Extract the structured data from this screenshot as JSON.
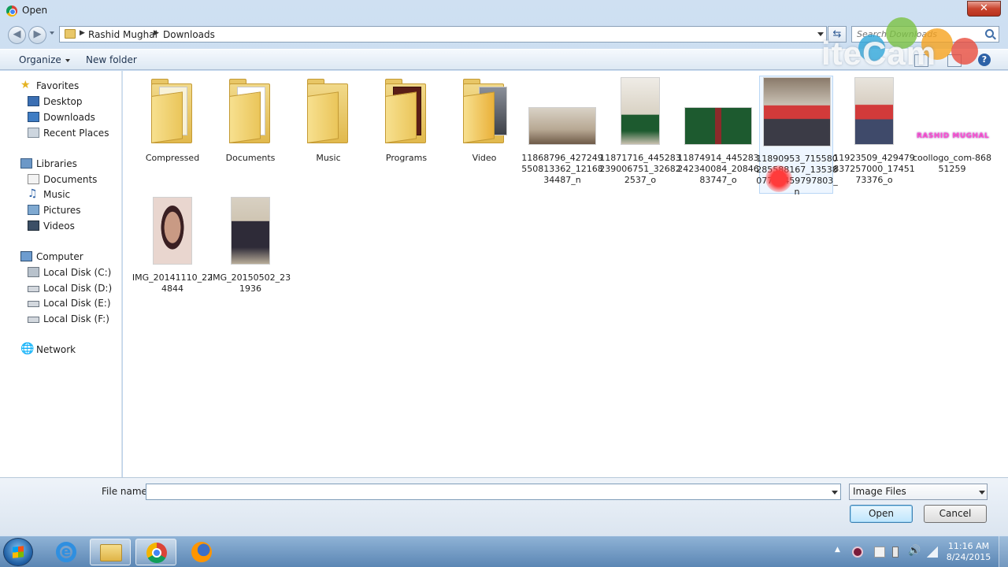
{
  "window": {
    "title": "Open",
    "close_label": "✕"
  },
  "address": {
    "crumbs": [
      "Rashid Mughal",
      "Downloads"
    ],
    "search_placeholder": "Search Downloads"
  },
  "toolbar": {
    "organize_label": "Organize",
    "new_folder_label": "New folder"
  },
  "watermark": "iteCam",
  "nav": {
    "favorites": {
      "label": "Favorites",
      "items": [
        "Desktop",
        "Downloads",
        "Recent Places"
      ]
    },
    "libraries": {
      "label": "Libraries",
      "items": [
        "Documents",
        "Music",
        "Pictures",
        "Videos"
      ]
    },
    "computer": {
      "label": "Computer",
      "items": [
        "Local Disk (C:)",
        "Local Disk (D:)",
        "Local Disk (E:)",
        "Local Disk (F:)"
      ]
    },
    "network": {
      "label": "Network"
    }
  },
  "files": [
    {
      "name": "Compressed",
      "kind": "folder"
    },
    {
      "name": "Documents",
      "kind": "folder"
    },
    {
      "name": "Music",
      "kind": "folder"
    },
    {
      "name": "Programs",
      "kind": "folder"
    },
    {
      "name": "Video",
      "kind": "folder"
    },
    {
      "name": "11868796_427249550813362_1216834487_n",
      "kind": "image"
    },
    {
      "name": "11871716_445283239006751_326822537_o",
      "kind": "image"
    },
    {
      "name": "11874914_445283242340084_2084683747_o",
      "kind": "image"
    },
    {
      "name": "11890953_715580285588167_1353807749459797803_n",
      "kind": "image"
    },
    {
      "name": "11923509_429479837257000_1745173376_o",
      "kind": "image"
    },
    {
      "name": "coollogo_com-86851259",
      "kind": "image",
      "logo_text": "RASHID MUGHAL"
    },
    {
      "name": "IMG_20141110_224844",
      "kind": "image"
    },
    {
      "name": "IMG_20150502_231936",
      "kind": "image"
    }
  ],
  "bottom": {
    "file_name_label": "File name:",
    "file_name_value": "",
    "filter_value": "Image Files",
    "open_label": "Open",
    "cancel_label": "Cancel"
  },
  "taskbar": {
    "time": "11:16 AM",
    "date": "8/24/2015"
  },
  "colors": {
    "accent": "#3c7fb1",
    "selection": "#dcebfc",
    "folder": "#e1b94d"
  }
}
